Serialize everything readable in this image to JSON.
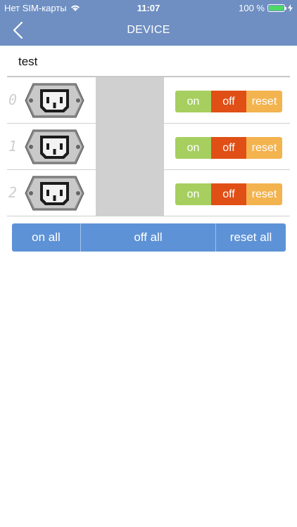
{
  "status_bar": {
    "carrier": "Нет SIM-карты",
    "time": "11:07",
    "battery_percent": "100 %"
  },
  "header": {
    "title": "DEVICE",
    "back_icon": "chevron-left-icon"
  },
  "device": {
    "name": "test"
  },
  "outlets": [
    {
      "number": "0",
      "on_label": "on",
      "off_label": "off",
      "reset_label": "reset"
    },
    {
      "number": "1",
      "on_label": "on",
      "off_label": "off",
      "reset_label": "reset"
    },
    {
      "number": "2",
      "on_label": "on",
      "off_label": "off",
      "reset_label": "reset"
    }
  ],
  "all_controls": {
    "on_all": "on all",
    "off_all": "off all",
    "reset_all": "reset all"
  },
  "colors": {
    "header": "#6f8fc2",
    "on": "#a6cf5f",
    "off": "#e04f16",
    "reset": "#f3b34f",
    "all_bar": "#5d92d6"
  }
}
